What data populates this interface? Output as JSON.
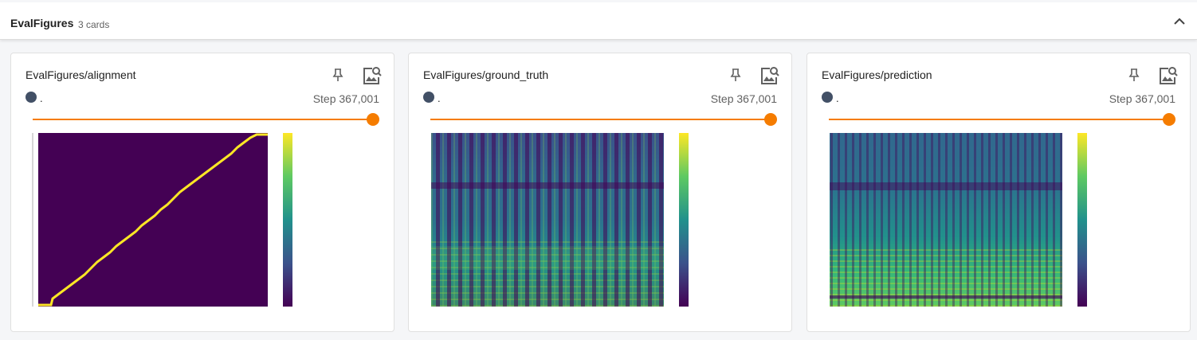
{
  "group": {
    "title": "EvalFigures",
    "count": "3 cards"
  },
  "icons": {
    "collapse": "chevron-up-icon",
    "pin": "pin-icon",
    "view": "image-search-icon"
  },
  "colors": {
    "accent": "#f57c00",
    "run": "#425066",
    "viridis_dark": "#440154",
    "viridis_yellow": "#fde725"
  },
  "cards": [
    {
      "title": "EvalFigures/alignment",
      "run": ".",
      "step": "Step 367,001"
    },
    {
      "title": "EvalFigures/ground_truth",
      "run": ".",
      "step": "Step 367,001"
    },
    {
      "title": "EvalFigures/prediction",
      "run": ".",
      "step": "Step 367,001"
    }
  ]
}
